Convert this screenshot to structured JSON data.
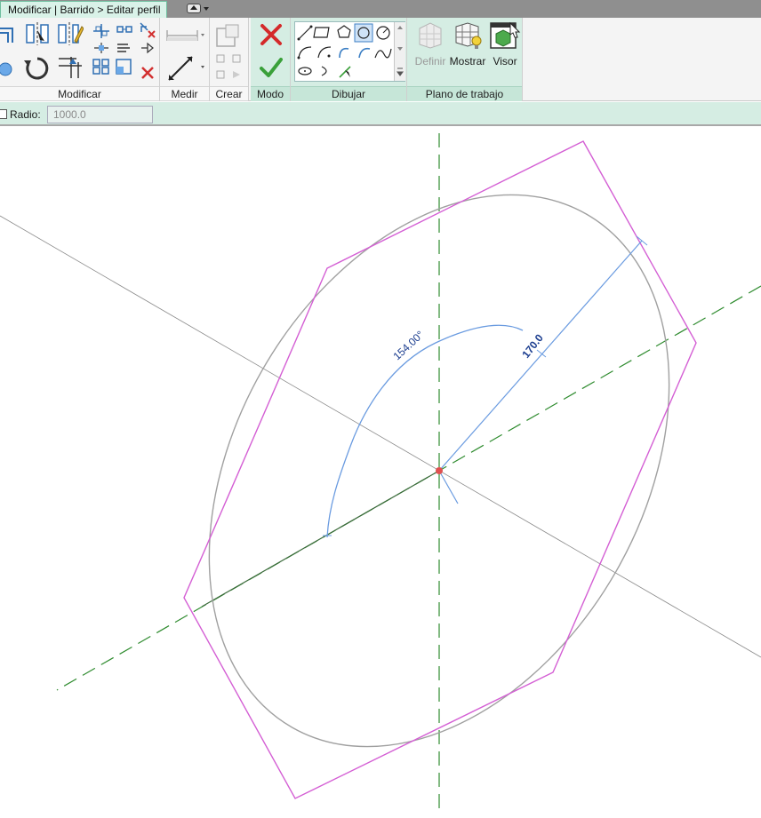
{
  "title_bar": {
    "context_tab_label": "Modificar | Barrido > Editar perfil",
    "quick_access_dropdown_icon": "ribbon-toggle-icon"
  },
  "ribbon": {
    "panels": {
      "modificar": "Modificar",
      "medir": "Medir",
      "crear": "Crear",
      "modo": "Modo",
      "dibujar": "Dibujar",
      "plano_de_trabajo": "Plano de trabajo"
    },
    "buttons": {
      "definir": "Definir",
      "mostrar": "Mostrar",
      "visor": "Visor"
    }
  },
  "options_bar": {
    "radius_label": "Radio:",
    "radius_value": "1000.0",
    "radius_checked": false
  },
  "canvas": {
    "angle_dimension": "154.00°",
    "radius_dimension": "170.0"
  },
  "colors": {
    "ribbon_green": "#d5ede3",
    "profile_magenta": "#d45fd4",
    "ellipse_gray": "#a0a0a0",
    "axis_green": "#2e8b2e",
    "dimension_blue": "#6a9be0",
    "dimension_text": "#1b3d8f",
    "origin_red": "#e05050"
  }
}
